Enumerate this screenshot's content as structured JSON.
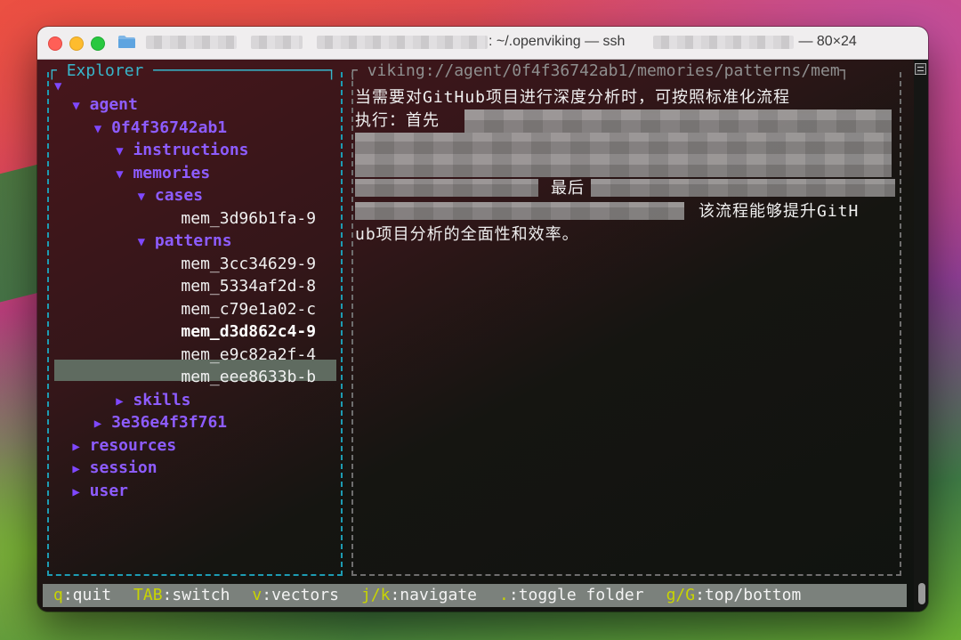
{
  "window": {
    "title_path": "~/.openviking",
    "title_sep_1": " — ",
    "title_cmd": "ssh",
    "title_sep_2": " — ",
    "title_size": "80×24"
  },
  "explorer": {
    "title": "Explorer",
    "root_arrow": "▼",
    "items": [
      {
        "arrow": "▼",
        "label": "agent",
        "type": "dir"
      },
      {
        "arrow": "▼",
        "label": "0f4f36742ab1",
        "type": "dir"
      },
      {
        "arrow": "▼",
        "label": "instructions",
        "type": "dir"
      },
      {
        "arrow": "▼",
        "label": "memories",
        "type": "dir"
      },
      {
        "arrow": "▼",
        "label": "cases",
        "type": "dir"
      },
      {
        "arrow": "",
        "label": "mem_3d96b1fa-9",
        "type": "file"
      },
      {
        "arrow": "▼",
        "label": "patterns",
        "type": "dir"
      },
      {
        "arrow": "",
        "label": "mem_3cc34629-9",
        "type": "file"
      },
      {
        "arrow": "",
        "label": "mem_5334af2d-8",
        "type": "file"
      },
      {
        "arrow": "",
        "label": "mem_c79e1a02-c",
        "type": "file"
      },
      {
        "arrow": "",
        "label": "mem_d3d862c4-9",
        "type": "file",
        "selected": true
      },
      {
        "arrow": "",
        "label": "mem_e9c82a2f-4",
        "type": "file"
      },
      {
        "arrow": "",
        "label": "mem_eee8633b-b",
        "type": "file"
      },
      {
        "arrow": "▶",
        "label": "skills",
        "type": "dir"
      },
      {
        "arrow": "▶",
        "label": "3e36e4f3f761",
        "type": "dir"
      },
      {
        "arrow": "▶",
        "label": "resources",
        "type": "dir"
      },
      {
        "arrow": "▶",
        "label": "session",
        "type": "dir"
      },
      {
        "arrow": "▶",
        "label": "user",
        "type": "dir"
      }
    ]
  },
  "content": {
    "path": "viking://agent/0f4f36742ab1/memories/patterns/mem",
    "line1": "当需要对GitHub项目进行深度分析时，可按照标准化流程",
    "line2": "执行：首先",
    "line5": "最后",
    "line6": "该流程能够提升GitH",
    "line7": "ub项目分析的全面性和效率。"
  },
  "statusbar": {
    "quit_key": "q",
    "quit_label": ":quit",
    "switch_key": "TAB",
    "switch_label": ":switch",
    "vectors_key": "v",
    "vectors_label": ":vectors",
    "navigate_key": "j/k",
    "navigate_label": ":navigate",
    "toggle_key": ".",
    "toggle_label": ":toggle folder",
    "topbottom_key": "g/G",
    "topbottom_label": ":top/bottom"
  },
  "colors": {
    "accent_cyan": "#1d9cb3",
    "dir_purple": "#8d5cff",
    "key_yellow": "#c8d400",
    "selection_bg": "#5f6b60"
  }
}
